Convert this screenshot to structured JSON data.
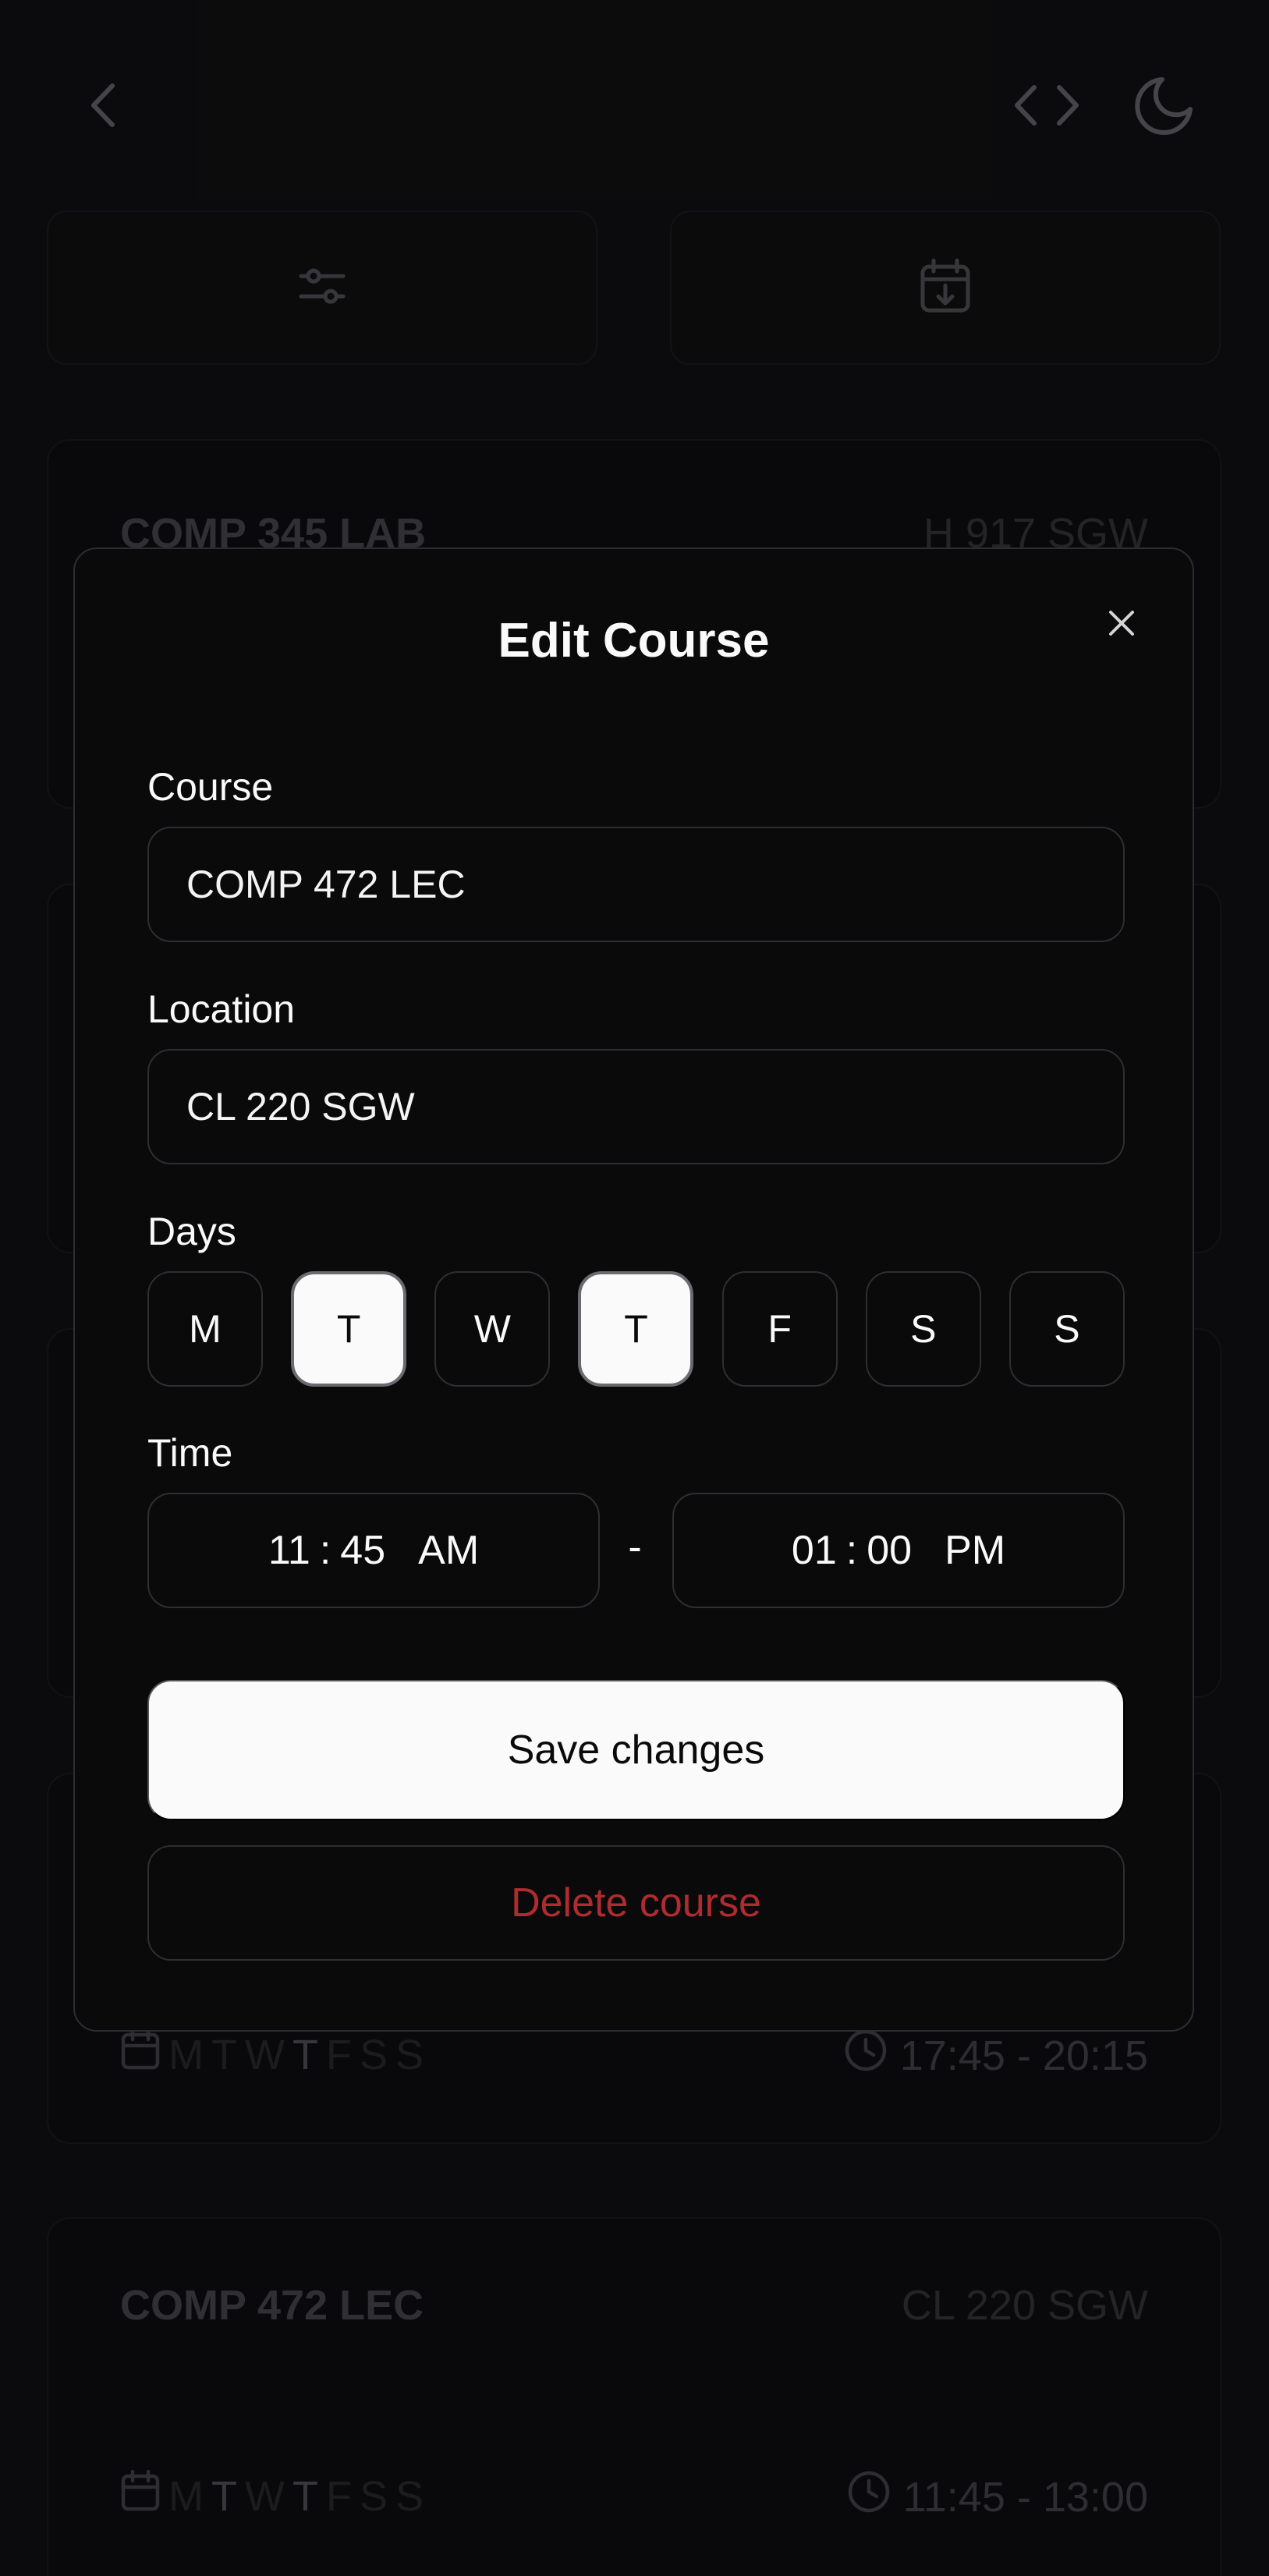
{
  "background": {
    "cards": [
      {
        "title": "COMP 345 LAB",
        "location": "H 917 SGW",
        "days": [
          "M",
          "T",
          "W",
          "T",
          "F",
          "S",
          "S"
        ],
        "active_days": [],
        "time": ""
      },
      {
        "title": "",
        "location": "",
        "days": [
          "M",
          "T",
          "W",
          "T",
          "F",
          "S",
          "S"
        ],
        "active_days": [
          3
        ],
        "time": "17:45 - 20:15"
      },
      {
        "title": "COMP 472 LEC",
        "location": "CL 220 SGW",
        "days": [
          "M",
          "T",
          "W",
          "T",
          "F",
          "S",
          "S"
        ],
        "active_days": [
          1,
          3
        ],
        "time": "11:45 - 13:00"
      }
    ]
  },
  "modal": {
    "title": "Edit Course",
    "course_label": "Course",
    "course_value": "COMP 472 LEC",
    "location_label": "Location",
    "location_value": "CL 220 SGW",
    "days_label": "Days",
    "days": [
      {
        "label": "M",
        "selected": false
      },
      {
        "label": "T",
        "selected": true
      },
      {
        "label": "W",
        "selected": false
      },
      {
        "label": "T",
        "selected": true
      },
      {
        "label": "F",
        "selected": false
      },
      {
        "label": "S",
        "selected": false
      },
      {
        "label": "S",
        "selected": false
      }
    ],
    "time_label": "Time",
    "start": {
      "hour": "11",
      "minute": "45",
      "period": "AM"
    },
    "end": {
      "hour": "01",
      "minute": "00",
      "period": "PM"
    },
    "time_separator": "-",
    "save_label": "Save changes",
    "delete_label": "Delete course"
  },
  "colors": {
    "danger": "#b02b30",
    "primary_button": "#fafafa",
    "surface": "#0a0a0b"
  },
  "icons": [
    "chevron-left-icon",
    "code-icon",
    "moon-icon",
    "sliders-icon",
    "calendar-download-icon",
    "close-icon",
    "calendar-icon",
    "clock-icon"
  ]
}
